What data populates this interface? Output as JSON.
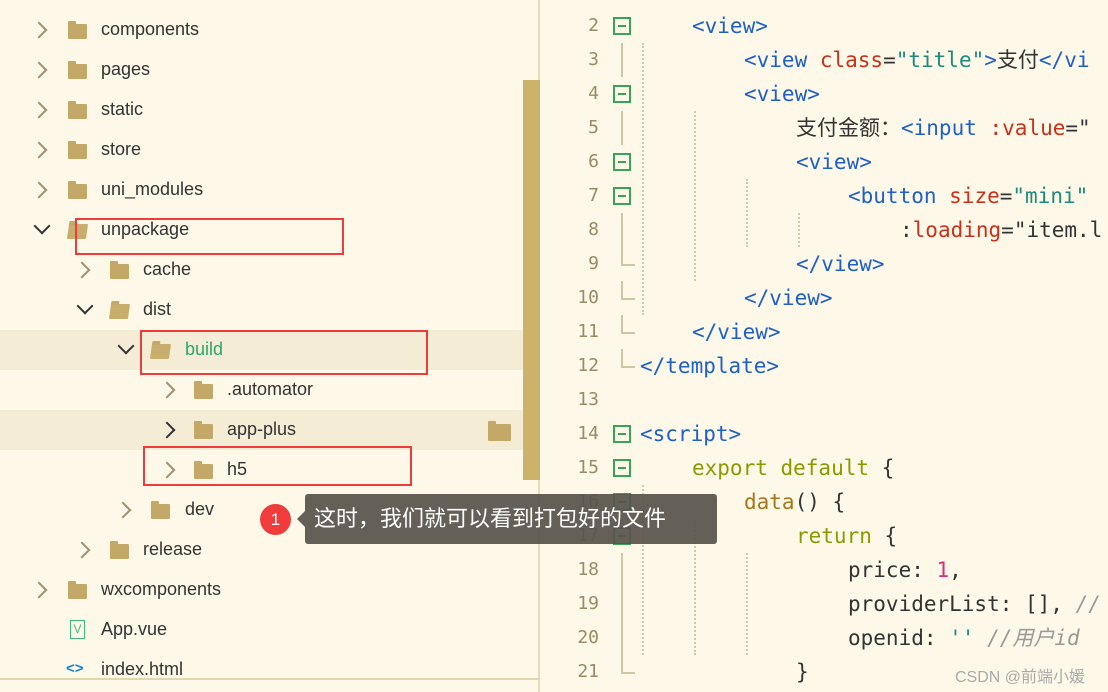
{
  "tree": {
    "items": [
      {
        "label": "components",
        "level": 0,
        "type": "folder",
        "state": "collapsed"
      },
      {
        "label": "pages",
        "level": 0,
        "type": "folder",
        "state": "collapsed"
      },
      {
        "label": "static",
        "level": 0,
        "type": "folder",
        "state": "collapsed"
      },
      {
        "label": "store",
        "level": 0,
        "type": "folder",
        "state": "collapsed"
      },
      {
        "label": "uni_modules",
        "level": 0,
        "type": "folder",
        "state": "collapsed"
      },
      {
        "label": "unpackage",
        "level": 0,
        "type": "folder",
        "state": "expanded",
        "boxed": true
      },
      {
        "label": "cache",
        "level": 1,
        "type": "folder",
        "state": "collapsed"
      },
      {
        "label": "dist",
        "level": 1,
        "type": "folder",
        "state": "expanded"
      },
      {
        "label": "build",
        "level": 2,
        "type": "folder",
        "state": "expanded",
        "selected": true,
        "boxed": true
      },
      {
        "label": ".automator",
        "level": 3,
        "type": "folder",
        "state": "collapsed"
      },
      {
        "label": "app-plus",
        "level": 3,
        "type": "folder",
        "state": "collapsed",
        "hover": true
      },
      {
        "label": "h5",
        "level": 3,
        "type": "folder",
        "state": "collapsed",
        "boxed": true
      },
      {
        "label": "dev",
        "level": 2,
        "type": "folder",
        "state": "collapsed"
      },
      {
        "label": "release",
        "level": 1,
        "type": "folder",
        "state": "collapsed"
      },
      {
        "label": "wxcomponents",
        "level": 0,
        "type": "folder",
        "state": "collapsed"
      },
      {
        "label": "App.vue",
        "level": 0,
        "type": "vue-file"
      },
      {
        "label": "index.html",
        "level": 0,
        "type": "html-file"
      }
    ]
  },
  "editor": {
    "lines": [
      {
        "n": "2",
        "indent": 1,
        "fold": true,
        "tokens": [
          [
            "tag",
            "<view>"
          ]
        ]
      },
      {
        "n": "3",
        "indent": 2,
        "tokens": [
          [
            "tag",
            "<view "
          ],
          [
            "attr",
            "class"
          ],
          [
            "plain",
            "="
          ],
          [
            "str",
            "\"title\""
          ],
          [
            "tag",
            ">"
          ],
          [
            "plain",
            "支付"
          ],
          [
            "tag",
            "</vi"
          ]
        ]
      },
      {
        "n": "4",
        "indent": 2,
        "fold": true,
        "tokens": [
          [
            "tag",
            "<view>"
          ]
        ]
      },
      {
        "n": "5",
        "indent": 3,
        "tokens": [
          [
            "plain",
            "支付金额："
          ],
          [
            "tag",
            "<input "
          ],
          [
            "attr",
            ":value"
          ],
          [
            "plain",
            "=\""
          ]
        ]
      },
      {
        "n": "6",
        "indent": 3,
        "fold": true,
        "tokens": [
          [
            "tag",
            "<view>"
          ]
        ]
      },
      {
        "n": "7",
        "indent": 4,
        "fold": true,
        "tokens": [
          [
            "tag",
            "<button "
          ],
          [
            "attr",
            "size"
          ],
          [
            "plain",
            "="
          ],
          [
            "str",
            "\"mini\""
          ]
        ]
      },
      {
        "n": "8",
        "indent": 5,
        "tokens": [
          [
            "plain",
            ":"
          ],
          [
            "attr",
            "loading"
          ],
          [
            "plain",
            "=\"item.l"
          ]
        ]
      },
      {
        "n": "9",
        "indent": 3,
        "end": true,
        "tokens": [
          [
            "tag",
            "</view>"
          ]
        ]
      },
      {
        "n": "10",
        "indent": 2,
        "end": true,
        "tokens": [
          [
            "tag",
            "</view>"
          ]
        ]
      },
      {
        "n": "11",
        "indent": 1,
        "end": true,
        "tokens": [
          [
            "tag",
            "</view>"
          ]
        ]
      },
      {
        "n": "12",
        "indent": 0,
        "end": true,
        "tokens": [
          [
            "tag",
            "</template>"
          ]
        ]
      },
      {
        "n": "13",
        "indent": 0,
        "tokens": []
      },
      {
        "n": "14",
        "indent": 0,
        "fold": true,
        "tokens": [
          [
            "tag",
            "<script>"
          ]
        ]
      },
      {
        "n": "15",
        "indent": 1,
        "fold": true,
        "tokens": [
          [
            "kw",
            "export default"
          ],
          [
            "plain",
            " {"
          ]
        ]
      },
      {
        "n": "16",
        "indent": 2,
        "fold": true,
        "tokens": [
          [
            "fn",
            "data"
          ],
          [
            "plain",
            "() {"
          ]
        ]
      },
      {
        "n": "17",
        "indent": 3,
        "fold": true,
        "tokens": [
          [
            "kw",
            "return"
          ],
          [
            "plain",
            " {"
          ]
        ]
      },
      {
        "n": "18",
        "indent": 4,
        "tokens": [
          [
            "plain",
            "price: "
          ],
          [
            "num",
            "1"
          ],
          [
            "plain",
            ","
          ]
        ]
      },
      {
        "n": "19",
        "indent": 4,
        "tokens": [
          [
            "plain",
            "providerList: [], "
          ],
          [
            "cmt",
            "//"
          ]
        ]
      },
      {
        "n": "20",
        "indent": 4,
        "tokens": [
          [
            "plain",
            "openid: "
          ],
          [
            "str",
            "''"
          ],
          [
            "cmt",
            " //用户id"
          ]
        ]
      },
      {
        "n": "21",
        "indent": 3,
        "end": true,
        "tokens": [
          [
            "plain",
            "}"
          ]
        ]
      }
    ]
  },
  "annotation": {
    "step": "1",
    "text": "这时，我们就可以看到打包好的文件"
  },
  "watermark": "CSDN @前端小媛",
  "colors": {
    "background": "#fdf8e7",
    "highlight": "#f4ecd5",
    "box": "#ee3b3b",
    "folder": "#c4a868",
    "selected_text": "#2aa86a"
  }
}
